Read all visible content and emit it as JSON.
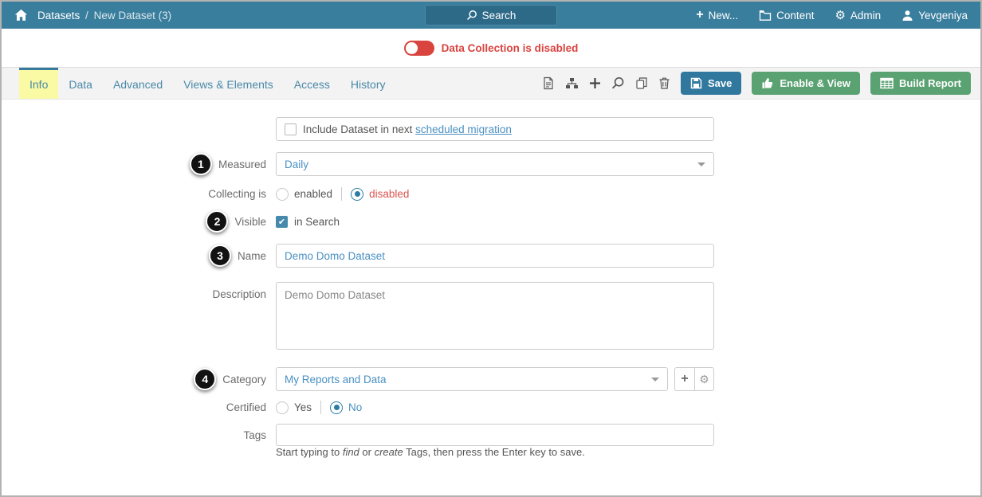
{
  "colors": {
    "header_teal": "#3a7e9d",
    "search_bg": "#2c6a88",
    "alert_red": "#d9443f",
    "link_blue": "#4a90c2",
    "tab_blue": "#4a89a8",
    "active_tab_yellow": "#fafaa4",
    "save_blue": "#31789f",
    "action_green": "#5ba273"
  },
  "header": {
    "breadcrumb": {
      "section": "Datasets",
      "separator": "/",
      "page": "New Dataset (3)"
    },
    "search_label": "Search",
    "nav": {
      "new_label": "New...",
      "content_label": "Content",
      "admin_label": "Admin",
      "user_label": "Yevgeniya"
    }
  },
  "banner": {
    "toggle_state": "off",
    "label": "Data Collection is disabled"
  },
  "tabs": [
    {
      "label": "Info",
      "active": true
    },
    {
      "label": "Data",
      "active": false
    },
    {
      "label": "Advanced",
      "active": false
    },
    {
      "label": "Views & Elements",
      "active": false
    },
    {
      "label": "Access",
      "active": false
    },
    {
      "label": "History",
      "active": false
    }
  ],
  "toolbar": {
    "icons": [
      "details-icon",
      "lineage-icon",
      "add-icon",
      "search-icon",
      "copy-icon",
      "delete-icon"
    ],
    "save_label": "Save",
    "enable_view_label": "Enable & View",
    "build_report_label": "Build Report"
  },
  "form": {
    "migration": {
      "checked": false,
      "text_prefix": "Include Dataset in next",
      "link_text": "scheduled migration"
    },
    "measured": {
      "step": "1",
      "label": "Measured",
      "value": "Daily"
    },
    "collecting": {
      "label": "Collecting is",
      "options": [
        {
          "label": "enabled",
          "selected": false
        },
        {
          "label": "disabled",
          "selected": true
        }
      ]
    },
    "visible": {
      "step": "2",
      "label": "Visible",
      "checked": true,
      "checkbox_label": "in Search",
      "checkmark": "✔"
    },
    "name": {
      "step": "3",
      "label": "Name",
      "value": "Demo Domo Dataset"
    },
    "description": {
      "label": "Description",
      "value": "Demo Domo Dataset"
    },
    "category": {
      "step": "4",
      "label": "Category",
      "value": "My Reports and Data"
    },
    "certified": {
      "label": "Certified",
      "options": [
        {
          "label": "Yes",
          "selected": false
        },
        {
          "label": "No",
          "selected": true
        }
      ]
    },
    "tags": {
      "label": "Tags",
      "value": "",
      "placeholder": ""
    },
    "tags_help": {
      "seg1": "Start typing to ",
      "find": "find",
      "seg2": " or ",
      "create": "create",
      "seg3": " Tags, then press the Enter key to save."
    }
  }
}
